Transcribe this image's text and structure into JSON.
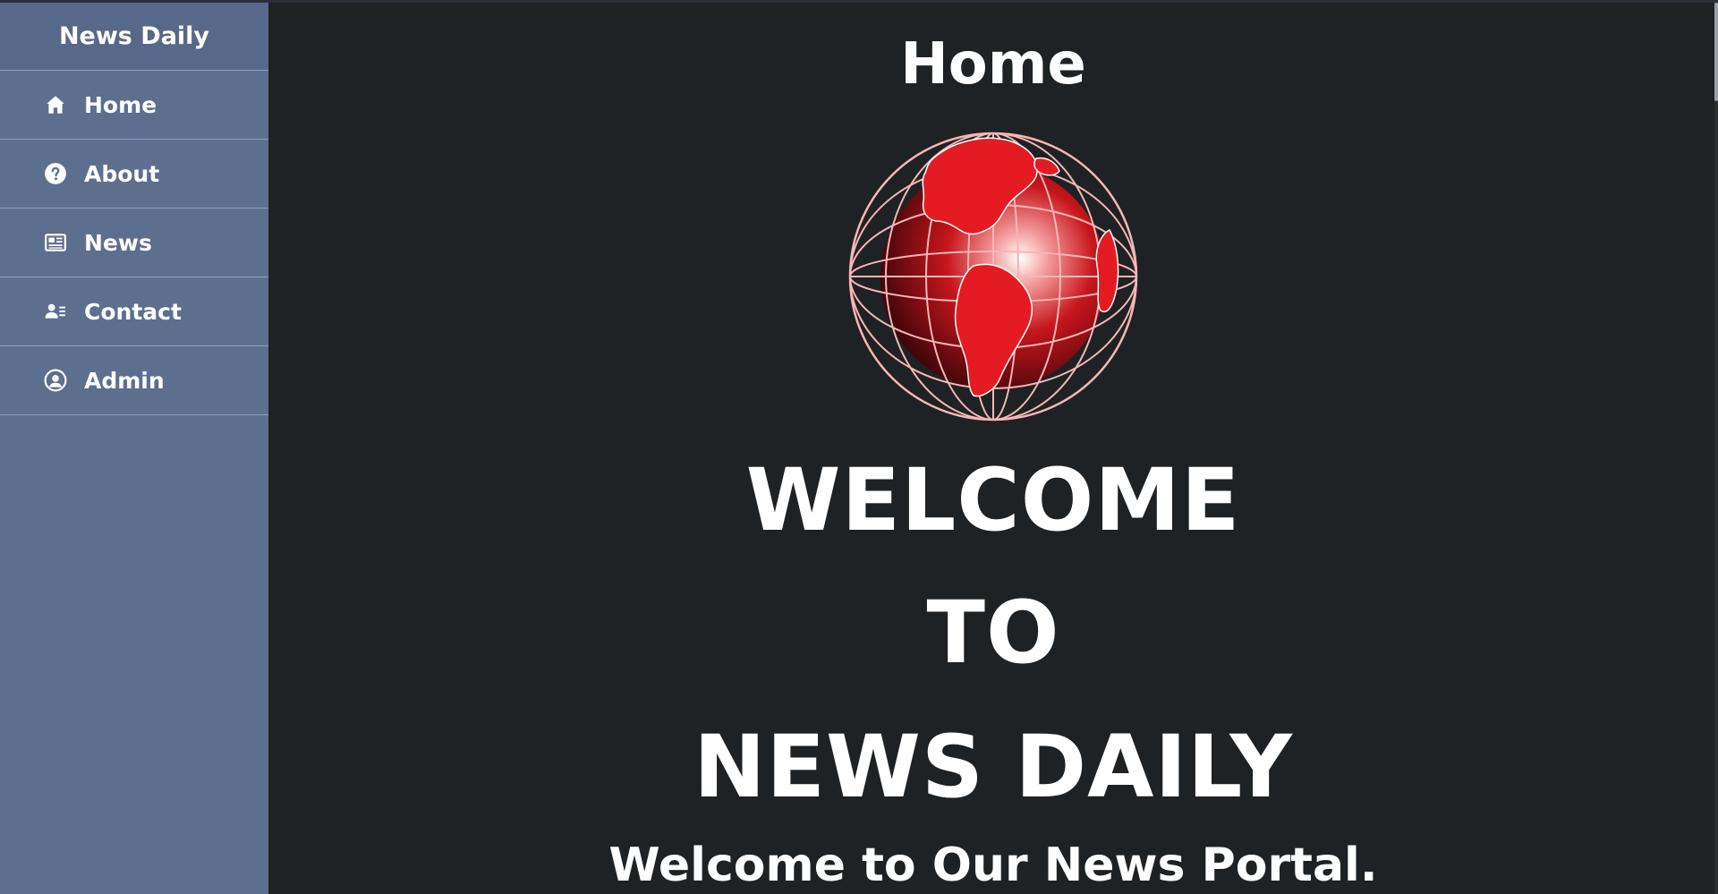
{
  "sidebar": {
    "brand": "News Daily",
    "items": [
      {
        "label": "Home",
        "icon": "home-icon"
      },
      {
        "label": "About",
        "icon": "question-circle-icon"
      },
      {
        "label": "News",
        "icon": "newspaper-icon"
      },
      {
        "label": "Contact",
        "icon": "contact-card-icon"
      },
      {
        "label": "Admin",
        "icon": "user-circle-icon"
      }
    ]
  },
  "main": {
    "page_title": "Home",
    "hero": [
      "WELCOME",
      "TO",
      "NEWS DAILY"
    ],
    "tagline": "Welcome to Our News Portal.",
    "logo_icon": "globe-logo-icon"
  },
  "colors": {
    "sidebar_bg": "#5c6f8f",
    "main_bg": "#1f2224",
    "globe_red": "#e51b23",
    "text": "#ffffff"
  }
}
